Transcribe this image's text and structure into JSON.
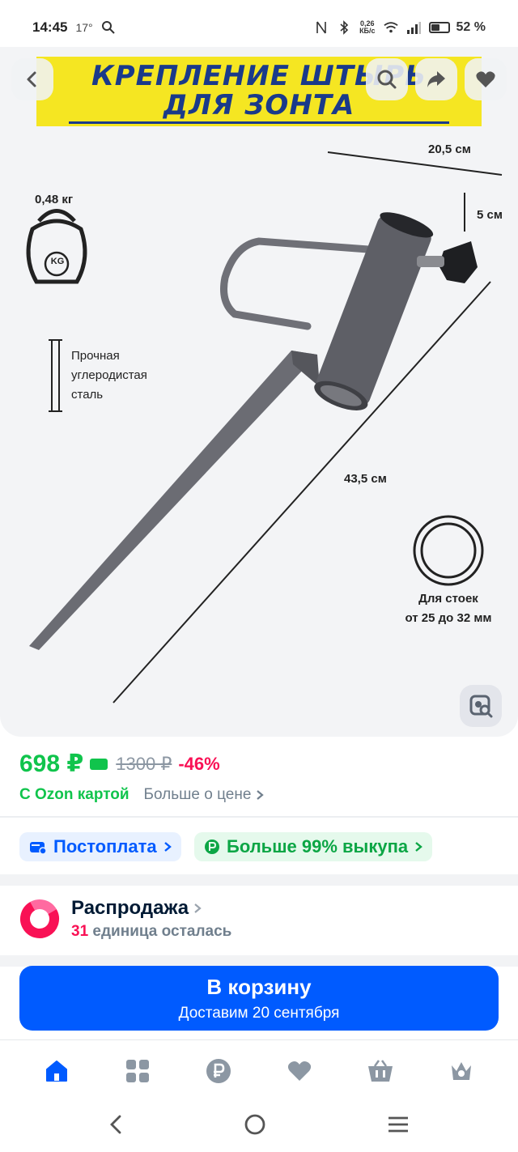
{
  "status_bar": {
    "time": "14:45",
    "temperature": "17°",
    "net_speed_value": "0,26",
    "net_speed_unit": "КБ/с",
    "battery": "52 %",
    "battery_level": 0.52
  },
  "gallery": {
    "banner_line1": "КРЕПЛЕНИЕ ШТЫРЬ",
    "banner_line2": "ДЛЯ ЗОНТА",
    "weight_label": "0,48 кг",
    "weight_icon_text": "KG",
    "dim_width": "20,5 см",
    "dim_height": "5 см",
    "dim_length": "43,5 см",
    "material_line1": "Прочная",
    "material_line2": "углеродистая",
    "material_line3": "сталь",
    "fit_line1": "Для стоек",
    "fit_line2": "от 25 до 32 мм"
  },
  "price": {
    "current": "698 ₽",
    "old": "1300 ₽",
    "discount": "-46%",
    "ozon_card": "С Ozon картой",
    "more_price": "Больше о цене"
  },
  "badges": {
    "postpay": "Постоплата",
    "buyout": "Больше 99% выкупа"
  },
  "sale": {
    "title": "Распродажа",
    "count": "31",
    "remaining": "единица осталась"
  },
  "cart": {
    "title": "В корзину",
    "delivery": "Доставим 20 сентября"
  },
  "colors": {
    "accent": "#005bff",
    "price_green": "#10c44c",
    "discount_pink": "#f91155",
    "banner_yellow": "#f5e622",
    "banner_blue": "#1a3a8a"
  }
}
